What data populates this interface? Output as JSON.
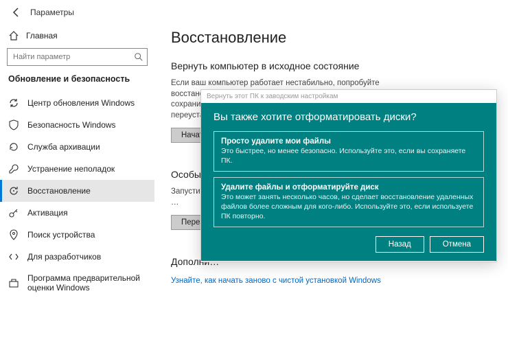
{
  "topbar": {
    "title": "Параметры"
  },
  "sidebar": {
    "home": "Главная",
    "search_placeholder": "Найти параметр",
    "section": "Обновление и безопасность",
    "items": [
      {
        "label": "Центр обновления Windows"
      },
      {
        "label": "Безопасность Windows"
      },
      {
        "label": "Служба архивации"
      },
      {
        "label": "Устранение неполадок"
      },
      {
        "label": "Восстановление"
      },
      {
        "label": "Активация"
      },
      {
        "label": "Поиск устройства"
      },
      {
        "label": "Для разработчиков"
      },
      {
        "label": "Программа предварительной оценки Windows"
      }
    ]
  },
  "main": {
    "title": "Восстановление",
    "reset": {
      "heading": "Вернуть компьютер в исходное состояние",
      "body": "Если ваш компьютер работает нестабильно, попробуйте восстановить его исходное состояние. Вы сможете при этом сохранить личные файлы или удалить их, а затем переустановить Windows.",
      "button": "Начать"
    },
    "advanced": {
      "heading": "Особые в…",
      "body": "Запустите си… накопителя … ПО компьютера … систему из …",
      "button": "Перезагру…"
    },
    "more": {
      "heading": "Дополни…",
      "link": "Узнайте, как начать заново с чистой установкой Windows"
    }
  },
  "dialog": {
    "frame_title": "Вернуть этот ПК к заводским настройкам",
    "heading": "Вы также хотите отформатировать диски?",
    "option1": {
      "title": "Просто удалите мои файлы",
      "desc": "Это быстрее, но менее безопасно. Используйте это, если вы сохраняете ПК."
    },
    "option2": {
      "title": "Удалите файлы и отформатируйте диск",
      "desc": "Это может занять несколько часов, но сделает восстановление удаленных файлов более сложным для кого-либо. Используйте это, если используете ПК повторно."
    },
    "back": "Назад",
    "cancel": "Отмена"
  }
}
